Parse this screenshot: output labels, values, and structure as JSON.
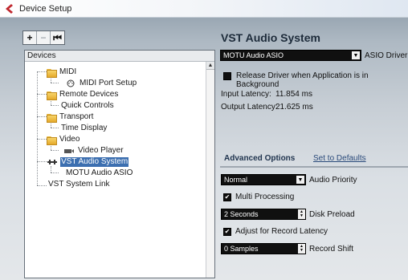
{
  "window": {
    "title": "Device Setup",
    "icon": "cubase-icon",
    "accent": "#c0272d"
  },
  "toolbar": {
    "add_label": "+",
    "remove_label": "−",
    "reset_label": "⏮"
  },
  "devices": {
    "header": "Devices",
    "items": [
      {
        "label": "MIDI",
        "icon": "folder-icon"
      },
      {
        "label": "MIDI Port Setup",
        "icon": "midi-port-icon"
      },
      {
        "label": "Remote Devices",
        "icon": "folder-icon"
      },
      {
        "label": "Quick Controls",
        "icon": ""
      },
      {
        "label": "Transport",
        "icon": "folder-icon"
      },
      {
        "label": "Time Display",
        "icon": ""
      },
      {
        "label": "Video",
        "icon": "folder-icon"
      },
      {
        "label": "Video Player",
        "icon": "video-player-icon"
      },
      {
        "label": "VST Audio System",
        "icon": "vst-audio-icon"
      },
      {
        "label": "MOTU Audio ASIO",
        "icon": ""
      },
      {
        "label": "VST System Link",
        "icon": ""
      }
    ],
    "selected": "VST Audio System"
  },
  "panel": {
    "title": "VST Audio System",
    "asio_driver": {
      "value": "MOTU Audio ASIO",
      "label": "ASIO Driver"
    },
    "release_driver": {
      "label": "Release Driver when Application is in Background",
      "checked": false
    },
    "input_latency": {
      "label": "Input Latency:",
      "value": "11.854 ms"
    },
    "output_latency": {
      "label": "Output Latency:",
      "value": "21.625 ms"
    },
    "tabs": {
      "advanced": "Advanced Options",
      "defaults": "Set to Defaults"
    },
    "audio_priority": {
      "value": "Normal",
      "label": "Audio Priority"
    },
    "multi_processing": {
      "label": "Multi Processing",
      "checked": true
    },
    "disk_preload": {
      "value": "2 Seconds",
      "label": "Disk Preload"
    },
    "adjust_latency": {
      "label": "Adjust for Record Latency",
      "checked": true
    },
    "record_shift": {
      "value": "0 Samples",
      "label": "Record Shift"
    }
  }
}
